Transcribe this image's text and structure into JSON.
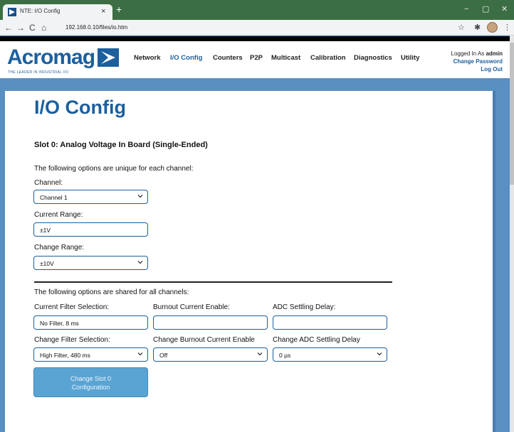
{
  "browser": {
    "tab_title": "NTE: I/O Config",
    "tab_close": "×",
    "new_tab": "+",
    "url": "192.168.0.10/files/io.htm",
    "back": "←",
    "forward": "→",
    "reload": "C",
    "home": "⌂",
    "star": "☆",
    "extensions": "✱",
    "menu": "⋮",
    "minimize": "−",
    "maximize": "▢",
    "close": "✕"
  },
  "header": {
    "logo_text": "Acromag",
    "logo_tagline": "THE LEADER IN INDUSTRIAL I/O",
    "nav": [
      {
        "label": "Network"
      },
      {
        "label": "I/O Config"
      },
      {
        "label": "Counters"
      },
      {
        "label": "P2P"
      },
      {
        "label": "Multicast"
      },
      {
        "label": "Calibration"
      },
      {
        "label": "Diagnostics"
      },
      {
        "label": "Utility"
      }
    ],
    "logged_in_prefix": "Logged In As ",
    "username": "admin",
    "change_password": "Change Password",
    "logout": "Log Out"
  },
  "page": {
    "title": "I/O Config",
    "slot_title": "Slot 0: Analog Voltage In Board (Single-Ended)",
    "unique_intro": "The following options are unique for each channel:",
    "channel_label": "Channel:",
    "channel_value": "Channel 1",
    "current_range_label": "Current Range:",
    "current_range_value": "±1V",
    "change_range_label": "Change Range:",
    "change_range_value": "±10V",
    "shared_intro": "The following options are shared for all channels:",
    "current_filter_label": "Current Filter Selection:",
    "current_filter_value": "No Filter, 8 ms",
    "burnout_label": "Burnout Current Enable:",
    "burnout_value": "",
    "adc_delay_label": "ADC Settling Delay:",
    "adc_delay_value": "",
    "change_filter_label": "Change Filter Selection:",
    "change_filter_value": "High Filter, 480 ms",
    "change_burnout_label": "Change Burnout Current Enable",
    "change_burnout_value": "Off",
    "change_adc_label": "Change ADC Settling Delay",
    "change_adc_value": "0 µs",
    "submit_line1": "Change Slot 0",
    "submit_line2": "Configuration"
  },
  "colors": {
    "brand": "#1c5f9e",
    "chrome": "#3c6e43",
    "band": "#5a8fc1",
    "button": "#5aa4d4"
  }
}
